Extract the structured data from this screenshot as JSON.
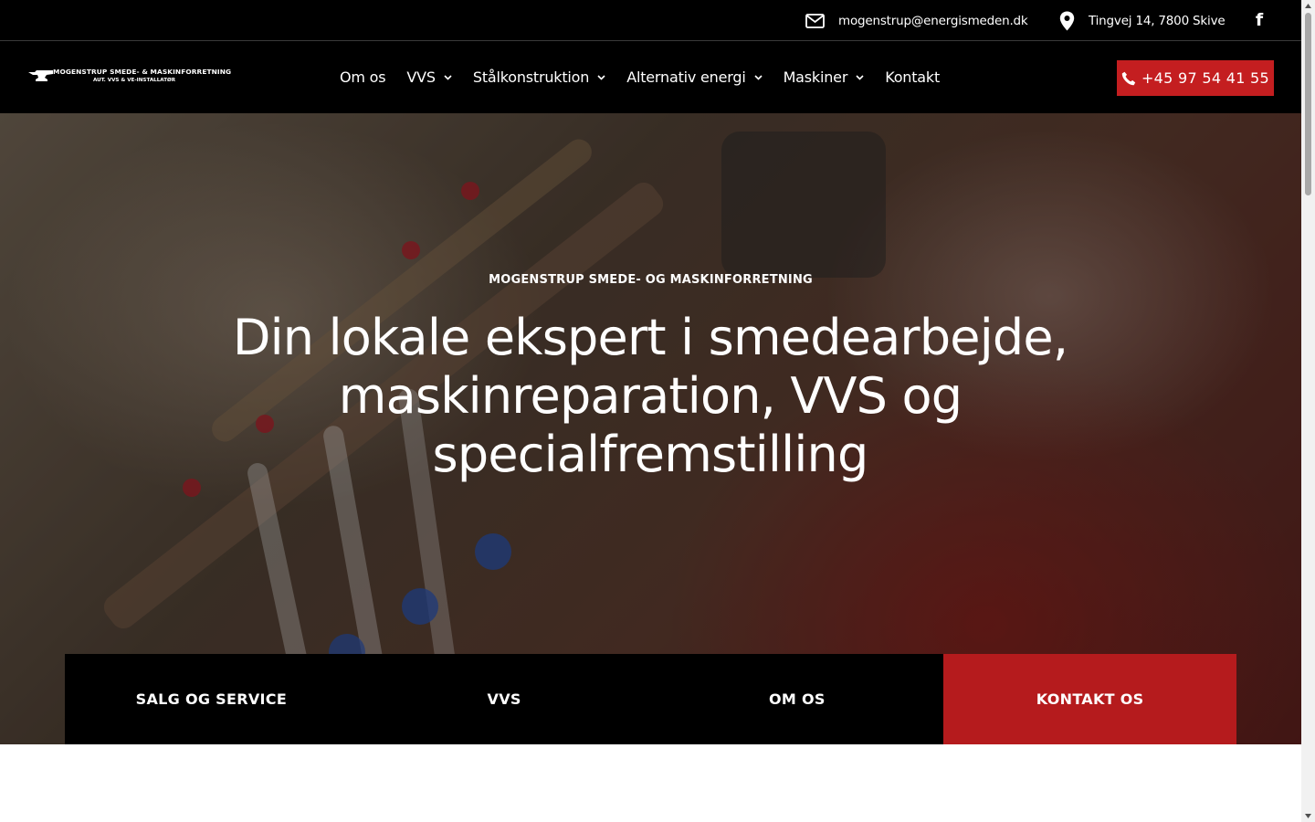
{
  "topbar": {
    "email": "mogenstrup@energismeden.dk",
    "address": "Tingvej 14, 7800 Skive",
    "email_icon": "envelope-icon",
    "address_icon": "map-pin-icon",
    "social_icon": "facebook-icon",
    "social_label": "f"
  },
  "header": {
    "logo_line1": "MOGENSTRUP SMEDE- & MASKINFORRETNING",
    "logo_line2": "AUT. VVS & VE-INSTALLATØR",
    "nav": [
      {
        "label": "Om os"
      },
      {
        "label": "VVS"
      },
      {
        "label": "Stålkonstruktion"
      },
      {
        "label": "Alternativ energi"
      },
      {
        "label": "Maskiner"
      },
      {
        "label": "Kontakt"
      }
    ],
    "phone": "+45 97 54 41 55"
  },
  "hero": {
    "eyebrow": "MOGENSTRUP SMEDE- OG MASKINFORRETNING",
    "headline_line1": "Din lokale ekspert i smedearbejde,",
    "headline_line2": "maskinreparation, VVS og",
    "headline_line3": "specialfremstilling"
  },
  "features": [
    {
      "label": "SALG OG SERVICE"
    },
    {
      "label": "VVS"
    },
    {
      "label": "OM OS"
    },
    {
      "label": "KONTAKT OS"
    }
  ],
  "colors": {
    "accent_red": "#c41e20",
    "header_bg": "#000000"
  }
}
